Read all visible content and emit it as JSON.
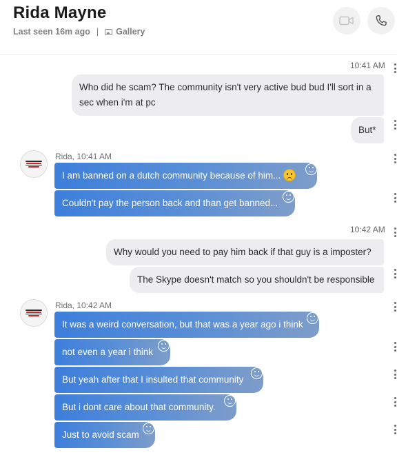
{
  "header": {
    "name": "Rida Mayne",
    "last_seen": "Last seen 16m ago",
    "separator": "|",
    "gallery_label": "Gallery",
    "video_icon": "video-camera-icon",
    "call_icon": "phone-icon"
  },
  "messages": {
    "ts1": "10:41 AM",
    "out1": "Who did he scam? The community isn't very active bud bud I'll sort in a sec when i'm at pc",
    "out2": "But*",
    "sender1": "Rida, 10:41 AM",
    "in1": "I am banned on a dutch community because of him...",
    "in1_emoji": "frowning-face-emoji",
    "in2": "Couldn't pay the person back and than get banned...",
    "ts2": "10:42 AM",
    "out3": "Why would you need to pay him back if that guy is a imposter?",
    "out4": "The Skype doesn't match so you shouldn't be responsible",
    "sender2": "Rida, 10:42 AM",
    "in3": "It was a weird conversation, but that was a year ago i think",
    "in4": "not even a year i think",
    "in5": "But yeah after that I insulted that community",
    "in6": "But i dont care about that community.",
    "in7": "Just to avoid scam"
  },
  "colors": {
    "incoming_start": "#3d7fdc",
    "incoming_end": "#7e9dc9",
    "outgoing_bg": "#ededef"
  }
}
